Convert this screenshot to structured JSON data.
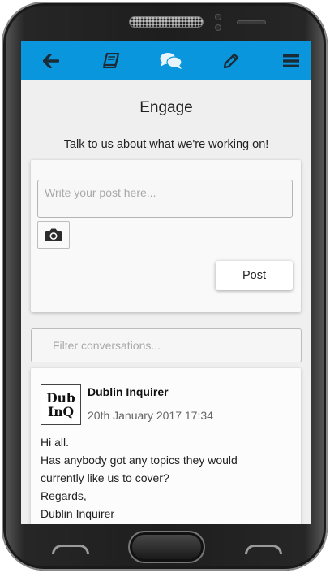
{
  "colors": {
    "navbar": "#0a96dc",
    "screen_bg": "#efefef",
    "card_bg": "#f9f9f9"
  },
  "navbar": {
    "items": [
      {
        "icon": "arrow-left-icon",
        "label": "Back"
      },
      {
        "icon": "book-icon",
        "label": "Guide"
      },
      {
        "icon": "comments-icon",
        "label": "Engage"
      },
      {
        "icon": "pencil-icon",
        "label": "Write"
      },
      {
        "icon": "menu-icon",
        "label": "Menu"
      }
    ]
  },
  "page": {
    "title": "Engage",
    "subtitle": "Talk to us about what we're working on!"
  },
  "composer": {
    "placeholder": "Write your post here...",
    "value": "",
    "camera_icon": "camera-icon",
    "post_label": "Post"
  },
  "filter": {
    "placeholder": "Filter conversations...",
    "value": ""
  },
  "conversations": [
    {
      "logo_lines": [
        "Dub",
        "InQ"
      ],
      "author": "Dublin Inquirer",
      "timestamp": "20th January 2017 17:34",
      "message_lines": [
        "Hi all.",
        "Has anybody got any topics they would",
        "currently like us to cover?",
        "Regards,",
        "Dublin Inquirer"
      ]
    }
  ]
}
